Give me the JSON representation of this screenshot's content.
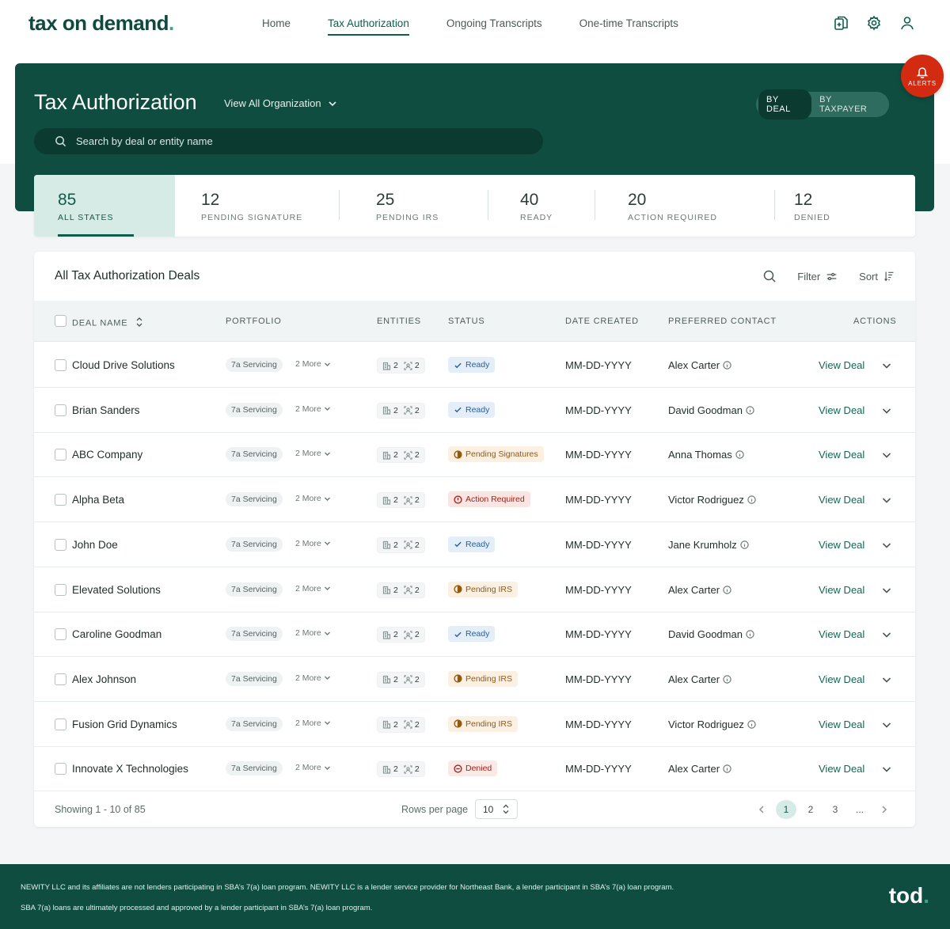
{
  "brand": {
    "name": "tax on demand",
    "dot": "."
  },
  "nav": {
    "links": [
      "Home",
      "Tax Authorization",
      "Ongoing Transcripts",
      "One-time Transcripts"
    ],
    "active_index": 1
  },
  "hero": {
    "title": "Tax Authorization",
    "org_select": "View All Organization",
    "search_placeholder": "Search by deal or entity name",
    "view_toggle": {
      "options": [
        "BY DEAL",
        "BY TAXPAYER"
      ],
      "selected": "BY DEAL"
    }
  },
  "alerts": {
    "label": "ALERTS"
  },
  "stats": [
    {
      "count": "85",
      "label": "ALL STATES"
    },
    {
      "count": "12",
      "label": "PENDING SIGNATURE"
    },
    {
      "count": "25",
      "label": "PENDING IRS"
    },
    {
      "count": "40",
      "label": "READY"
    },
    {
      "count": "20",
      "label": "ACTION REQUIRED"
    },
    {
      "count": "12",
      "label": "DENIED"
    }
  ],
  "table": {
    "title": "All Tax Authorization Deals",
    "filter_label": "Filter",
    "sort_label": "Sort",
    "columns": [
      "DEAL NAME",
      "PORTFOLIO",
      "ENTITIES",
      "STATUS",
      "DATE CREATED",
      "PREFERRED CONTACT",
      "ACTIONS"
    ],
    "rows": [
      {
        "deal": "Cloud Drive Solutions",
        "portfolio": "7a Servicing",
        "more": "2 More",
        "ent_a": "2",
        "ent_b": "2",
        "status": "Ready",
        "status_kind": "ready",
        "date": "MM-DD-YYYY",
        "contact": "Alex Carter",
        "action": "View Deal"
      },
      {
        "deal": "Brian Sanders",
        "portfolio": "7a Servicing",
        "more": "2 More",
        "ent_a": "2",
        "ent_b": "2",
        "status": "Ready",
        "status_kind": "ready",
        "date": "MM-DD-YYYY",
        "contact": "David Goodman",
        "action": "View Deal"
      },
      {
        "deal": "ABC Company",
        "portfolio": "7a Servicing",
        "more": "2 More",
        "ent_a": "2",
        "ent_b": "2",
        "status": "Pending Signatures",
        "status_kind": "pending",
        "date": "MM-DD-YYYY",
        "contact": "Anna Thomas",
        "action": "View Deal"
      },
      {
        "deal": "Alpha Beta",
        "portfolio": "7a Servicing",
        "more": "2 More",
        "ent_a": "2",
        "ent_b": "2",
        "status": "Action Required",
        "status_kind": "action",
        "date": "MM-DD-YYYY",
        "contact": "Victor Rodriguez",
        "action": "View Deal"
      },
      {
        "deal": "John Doe",
        "portfolio": "7a Servicing",
        "more": "2 More",
        "ent_a": "2",
        "ent_b": "2",
        "status": "Ready",
        "status_kind": "ready",
        "date": "MM-DD-YYYY",
        "contact": "Jane Krumholz",
        "action": "View Deal"
      },
      {
        "deal": "Elevated Solutions",
        "portfolio": "7a Servicing",
        "more": "2 More",
        "ent_a": "2",
        "ent_b": "2",
        "status": "Pending IRS",
        "status_kind": "pending",
        "date": "MM-DD-YYYY",
        "contact": "Alex Carter",
        "action": "View Deal"
      },
      {
        "deal": "Caroline Goodman",
        "portfolio": "7a Servicing",
        "more": "2 More",
        "ent_a": "2",
        "ent_b": "2",
        "status": "Ready",
        "status_kind": "ready",
        "date": "MM-DD-YYYY",
        "contact": "David Goodman",
        "action": "View Deal"
      },
      {
        "deal": "Alex Johnson",
        "portfolio": "7a Servicing",
        "more": "2 More",
        "ent_a": "2",
        "ent_b": "2",
        "status": "Pending IRS",
        "status_kind": "pending",
        "date": "MM-DD-YYYY",
        "contact": "Alex Carter",
        "action": "View Deal"
      },
      {
        "deal": "Fusion Grid Dynamics",
        "portfolio": "7a Servicing",
        "more": "2 More",
        "ent_a": "2",
        "ent_b": "2",
        "status": "Pending IRS",
        "status_kind": "pending",
        "date": "MM-DD-YYYY",
        "contact": "Victor Rodriguez",
        "action": "View Deal"
      },
      {
        "deal": "Innovate X Technologies",
        "portfolio": "7a Servicing",
        "more": "2 More",
        "ent_a": "2",
        "ent_b": "2",
        "status": "Denied",
        "status_kind": "denied",
        "date": "MM-DD-YYYY",
        "contact": "Alex Carter",
        "action": "View Deal"
      }
    ]
  },
  "pagination": {
    "showing": "Showing 1 - 10 of 85",
    "rows_per_page_label": "Rows per page",
    "rows_per_page": "10",
    "pages": [
      "1",
      "2",
      "3",
      "..."
    ],
    "current_page": "1"
  },
  "footer": {
    "line1": "NEWITY LLC and its affiliates are not lenders participating in SBA’s 7(a) loan program. NEWITY LLC is a lender service provider for Northeast Bank, a lender participant in SBA’s 7(a) loan program.",
    "line2": "SBA 7(a) loans are ultimately processed and approved by a lender participant in SBA’s 7(a) loan program.",
    "logo": "tod",
    "logo_dot": "."
  },
  "colors": {
    "brand_dark": "#0e4d40",
    "brand_accent": "#3aa582",
    "alert_red": "#d32a12",
    "ready": "#2b5f93",
    "pending": "#915a12",
    "action": "#a12419"
  },
  "icons": {
    "nav": [
      "documents-icon",
      "gear-icon",
      "user-icon"
    ],
    "alerts": "bell-icon",
    "search": "search-icon"
  }
}
